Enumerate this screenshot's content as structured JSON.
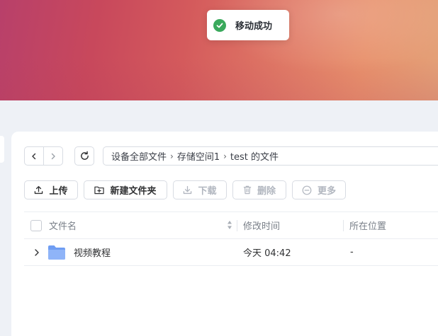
{
  "toast": {
    "message": "移动成功",
    "icon": "check-circle-icon",
    "color": "#3aa95c"
  },
  "navigation": {
    "back_icon": "chevron-left-icon",
    "forward_icon": "chevron-right-icon",
    "refresh_icon": "refresh-icon"
  },
  "breadcrumb": {
    "items": [
      "设备全部文件",
      "存储空间1",
      "test 的文件"
    ],
    "separator": "›"
  },
  "toolbar": {
    "upload_label": "上传",
    "new_folder_label": "新建文件夹",
    "download_label": "下载",
    "delete_label": "删除",
    "more_label": "更多"
  },
  "table": {
    "columns": [
      "文件名",
      "修改时间",
      "所在位置"
    ],
    "rows": [
      {
        "name": "视频教程",
        "modified": "今天 04:42",
        "location": "-",
        "type": "folder"
      }
    ]
  },
  "colors": {
    "banner_start": "#b8406a",
    "banner_end": "#e3a178",
    "folder": "#7fa9f5",
    "disabled_text": "#b1b6bf"
  }
}
